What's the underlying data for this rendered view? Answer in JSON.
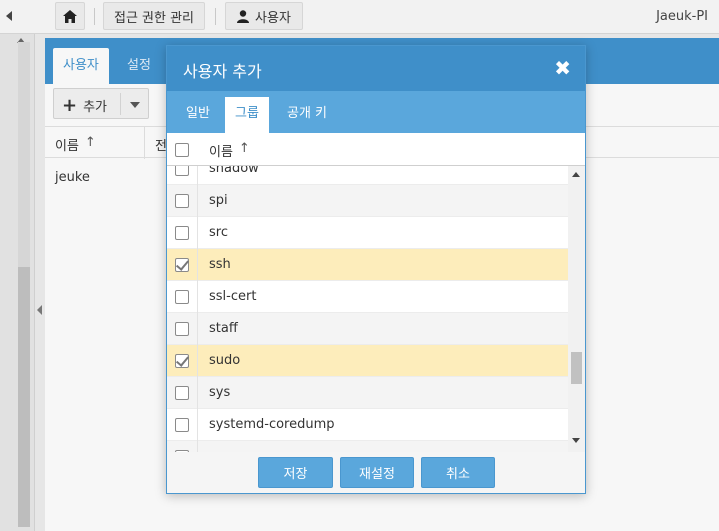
{
  "topbar": {
    "permission_label": "접근 권한 관리",
    "user_label": "사용자",
    "account_name": "Jaeuk-PI",
    "icons": [
      "home-icon",
      "user-icon",
      "collapse-left-icon"
    ]
  },
  "main": {
    "tabs": [
      {
        "label": "사용자"
      },
      {
        "label": "설정"
      }
    ],
    "add_label": "추가",
    "columns": [
      {
        "label": "이름"
      },
      {
        "label": "전"
      }
    ],
    "rows": [
      {
        "name": "jeuke"
      }
    ]
  },
  "modal": {
    "title": "사용자 추가",
    "tabs": [
      {
        "label": "일반"
      },
      {
        "label": "그룹"
      },
      {
        "label": "공개 키"
      }
    ],
    "active_tab": "그룹",
    "list_header": "이름",
    "groups": [
      {
        "name": "shadow",
        "checked": false
      },
      {
        "name": "spi",
        "checked": false
      },
      {
        "name": "src",
        "checked": false
      },
      {
        "name": "ssh",
        "checked": true
      },
      {
        "name": "ssl-cert",
        "checked": false
      },
      {
        "name": "staff",
        "checked": false
      },
      {
        "name": "sudo",
        "checked": true
      },
      {
        "name": "sys",
        "checked": false
      },
      {
        "name": "systemd-coredump",
        "checked": false
      },
      {
        "name": "",
        "checked": false
      }
    ],
    "buttons": {
      "save": "저장",
      "reset": "재설정",
      "cancel": "취소"
    }
  },
  "colors": {
    "accent": "#3f8fc9",
    "accent_light": "#5aa7dc",
    "selected_row": "#fdedbb"
  }
}
